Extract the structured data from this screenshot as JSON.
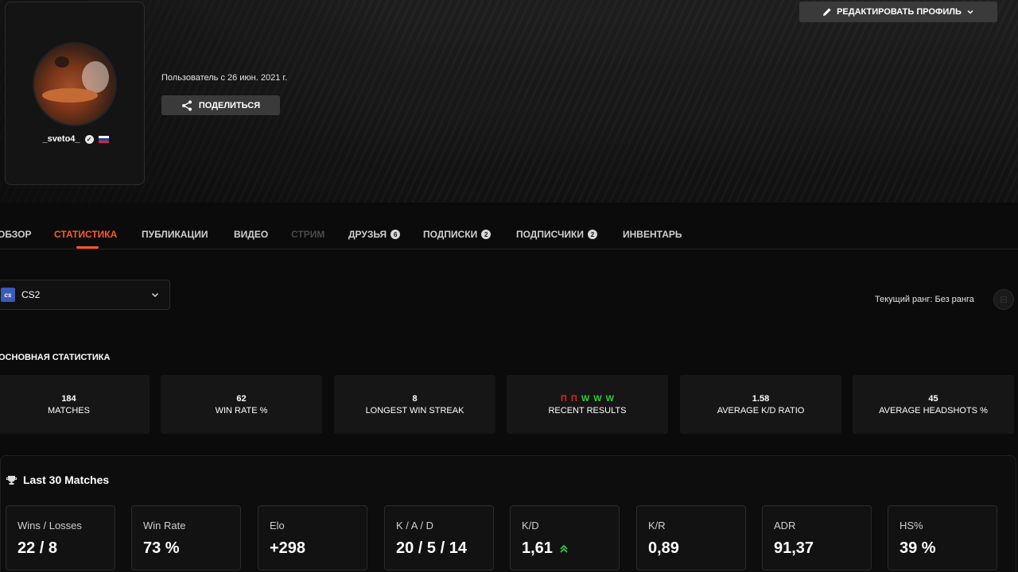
{
  "header": {
    "edit_profile_label": "РЕДАКТИРОВАТЬ ПРОФИЛЬ",
    "member_since": "Пользователь с 26 июн. 2021 г.",
    "share_label": "ПОДЕЛИТЬСЯ"
  },
  "profile": {
    "username": "_sveto4_",
    "flag_colors": [
      "#ffffff",
      "#1c3fb7",
      "#d52b1e"
    ]
  },
  "tabs": [
    {
      "label": "ОБЗОР",
      "count": null,
      "state": "normal"
    },
    {
      "label": "СТАТИСТИКА",
      "count": null,
      "state": "active"
    },
    {
      "label": "ПУБЛИКАЦИИ",
      "count": null,
      "state": "normal"
    },
    {
      "label": "ВИДЕО",
      "count": null,
      "state": "normal"
    },
    {
      "label": "СТРИМ",
      "count": null,
      "state": "disabled"
    },
    {
      "label": "ДРУЗЬЯ",
      "count": "6",
      "state": "normal"
    },
    {
      "label": "ПОДПИСКИ",
      "count": "2",
      "state": "normal"
    },
    {
      "label": "ПОДПИСЧИКИ",
      "count": "2",
      "state": "normal"
    },
    {
      "label": "ИНВЕНТАРЬ",
      "count": null,
      "state": "normal"
    }
  ],
  "game_select": {
    "logo_text": "cs",
    "selected": "CS2"
  },
  "rank": {
    "text": "Текущий ранг: Без ранга"
  },
  "main_stats": {
    "title": "ОСНОВНАЯ СТАТИСТИКА",
    "cards": [
      {
        "value": "184",
        "label": "MATCHES"
      },
      {
        "value": "62",
        "label": "WIN RATE %"
      },
      {
        "value": "8",
        "label": "LONGEST WIN STREAK"
      },
      {
        "value": null,
        "label": "RECENT RESULTS"
      },
      {
        "value": "1.58",
        "label": "AVERAGE K/D RATIO"
      },
      {
        "value": "45",
        "label": "AVERAGE HEADSHOTS %"
      }
    ],
    "recent_results": [
      {
        "letter": "П",
        "result": "loss"
      },
      {
        "letter": "П",
        "result": "loss"
      },
      {
        "letter": "W",
        "result": "win"
      },
      {
        "letter": "W",
        "result": "win"
      },
      {
        "letter": "W",
        "result": "win"
      }
    ]
  },
  "last30": {
    "title": "Last 30 Matches",
    "cards": [
      {
        "label": "Wins / Losses",
        "value": "22 / 8"
      },
      {
        "label": "Win Rate",
        "value": "73 %"
      },
      {
        "label": "Elo",
        "value": "+298"
      },
      {
        "label": "K / A / D",
        "value": "20 / 5 / 14"
      },
      {
        "label": "K/D",
        "value": "1,61",
        "trend": "up"
      },
      {
        "label": "K/R",
        "value": "0,89"
      },
      {
        "label": "ADR",
        "value": "91,37"
      },
      {
        "label": "HS%",
        "value": "39 %"
      }
    ]
  },
  "colors": {
    "accent": "#ff5a1f",
    "win": "#2ecc40",
    "loss": "#e02525"
  }
}
